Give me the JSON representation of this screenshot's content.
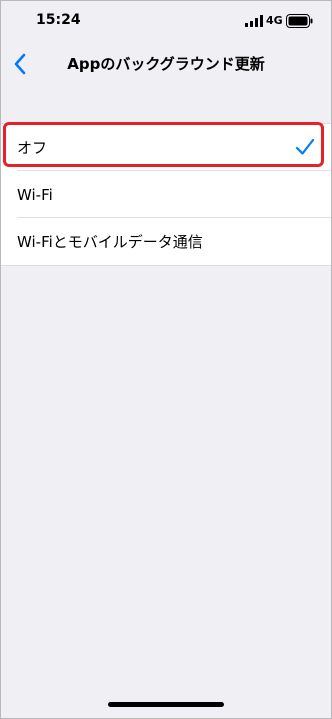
{
  "status_bar": {
    "time": "15:24",
    "network": "4G",
    "signal_icon": "cellular-signal-icon",
    "battery_icon": "battery-icon"
  },
  "nav": {
    "back_icon": "chevron-left-icon",
    "title": "Appのバックグラウンド更新"
  },
  "options": [
    {
      "label": "オフ",
      "selected": true
    },
    {
      "label": "Wi-Fi",
      "selected": false
    },
    {
      "label": "Wi-Fiとモバイルデータ通信",
      "selected": false
    }
  ],
  "colors": {
    "accent": "#007aff",
    "highlight": "#e8202a",
    "background": "#efeff4"
  }
}
